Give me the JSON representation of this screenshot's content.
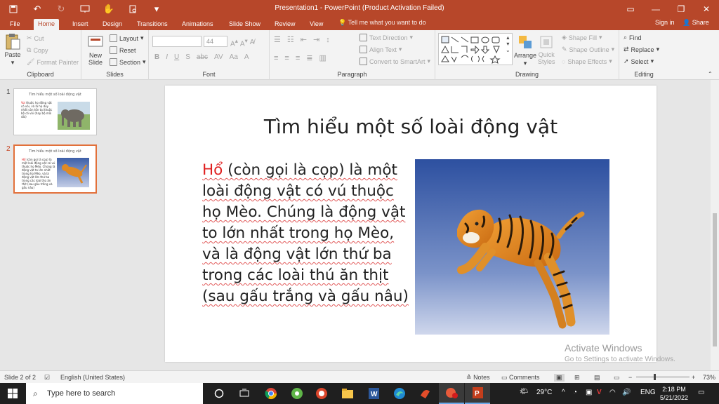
{
  "window": {
    "title": "Presentation1 - PowerPoint (Product Activation Failed)"
  },
  "tabs": [
    "File",
    "Home",
    "Insert",
    "Design",
    "Transitions",
    "Animations",
    "Slide Show",
    "Review",
    "View"
  ],
  "active_tab": "Home",
  "tell_me": "Tell me what you want to do",
  "sign_in": "Sign in",
  "share": "Share",
  "ribbon": {
    "clipboard": {
      "label": "Clipboard",
      "paste": "Paste",
      "cut": "Cut",
      "copy": "Copy",
      "format_painter": "Format Painter"
    },
    "slides": {
      "label": "Slides",
      "new_slide_1": "New",
      "new_slide_2": "Slide",
      "layout": "Layout",
      "reset": "Reset",
      "section": "Section"
    },
    "font": {
      "label": "Font",
      "font_size": "44"
    },
    "paragraph": {
      "label": "Paragraph",
      "text_direction": "Text Direction",
      "align_text": "Align Text",
      "convert_smartart": "Convert to SmartArt"
    },
    "drawing": {
      "label": "Drawing",
      "arrange": "Arrange",
      "quick_styles_1": "Quick",
      "quick_styles_2": "Styles",
      "shape_fill": "Shape Fill",
      "shape_outline": "Shape Outline",
      "shape_effects": "Shape Effects"
    },
    "editing": {
      "label": "Editing",
      "find": "Find",
      "replace": "Replace",
      "select": "Select"
    }
  },
  "thumbnails": [
    {
      "number": "1",
      "title": "Tìm hiểu một số loài động vật",
      "text_red": "Voi",
      "text": " thuộc họ động vật có vòi, và là họ duy nhất còn tồn tại thuộc bộ có vòi (hay bộ mũi dài)",
      "image": "elephant"
    },
    {
      "number": "2",
      "title": "Tìm hiểu một số loài động vật",
      "text_red": "Hổ",
      "text": " (còn gọi là cọp) là một loài động vật có vú thuộc họ Mèo. Chúng là động vật to lớn nhất trong họ Mèo, và là động vật lớn thứ ba trong các loài thú ăn thịt (sau gấu trắng và gấu nâu)",
      "image": "tiger"
    }
  ],
  "slide": {
    "title": "Tìm hiểu một số loài động vật",
    "body_red": "Hổ",
    "body": " (còn gọi là cọp) là một loài động vật có vú thuộc họ Mèo. Chúng là động vật to lớn nhất trong họ Mèo, và là động vật lớn thứ ba trong các loài thú ăn thịt (sau gấu trắng và gấu nâu)",
    "image": "tiger"
  },
  "watermark": {
    "line1": "Activate Windows",
    "line2": "Go to Settings to activate Windows."
  },
  "status": {
    "slide_counter": "Slide 2 of 2",
    "language": "English (United States)",
    "notes": "Notes",
    "comments": "Comments",
    "zoom": "73%"
  },
  "taskbar": {
    "search_placeholder": "Type here to search",
    "temperature": "29°C",
    "language": "ENG",
    "time": "2:18 PM",
    "date": "5/21/2022"
  },
  "colors": {
    "accent": "#b7472a",
    "selection": "#e2703a",
    "red_text": "#e02020"
  }
}
